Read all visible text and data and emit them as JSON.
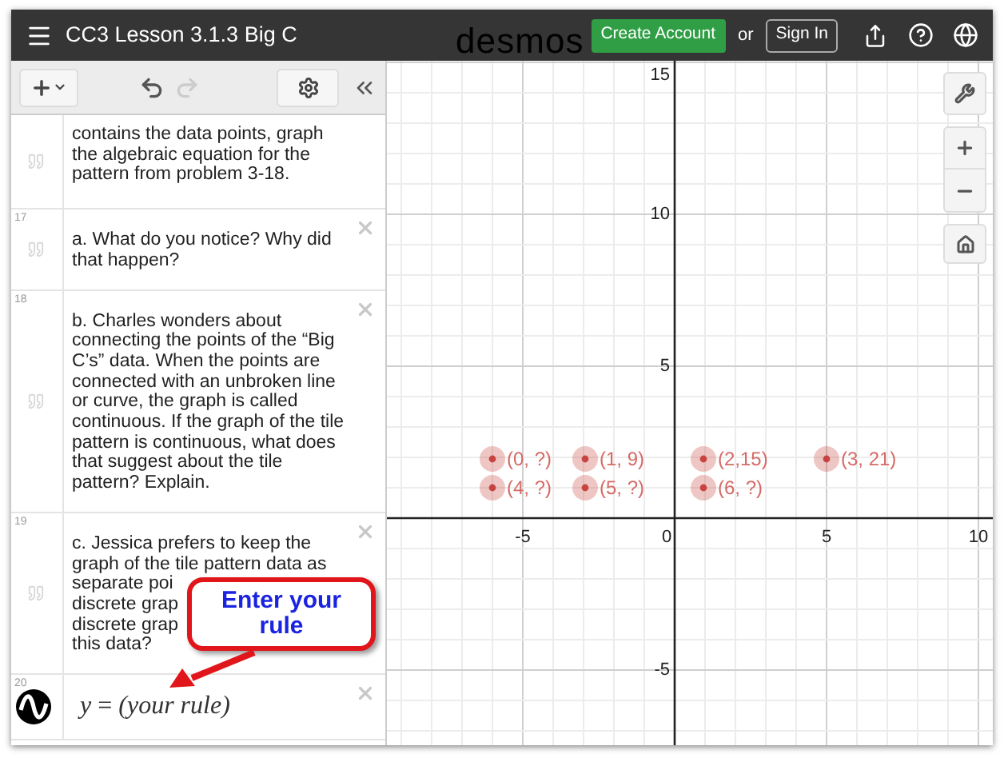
{
  "header": {
    "title": "CC3 Lesson 3.1.3 Big C",
    "brand": "desmos",
    "create_account": "Create Account",
    "or": "or",
    "sign_in": "Sign In"
  },
  "expressions": [
    {
      "kind": "note",
      "cut": true,
      "lines": [
        "contains the data points, graph",
        "the algebraic equation for the",
        "pattern from problem 3-18."
      ]
    },
    {
      "kind": "note",
      "cut": false,
      "number": "17",
      "lines": [
        "a. What do you notice? Why did",
        "that happen?"
      ]
    },
    {
      "kind": "note",
      "cut": false,
      "number": "18",
      "lines": [
        "b. Charles wonders about",
        "connecting the points of the “Big",
        "C’s” data.  When the points are",
        "connected with an unbroken line",
        "or curve, the graph is called",
        "continuous. If the graph of the tile",
        "pattern is continuous, what does",
        "that suggest about the tile",
        "pattern?  Explain."
      ]
    },
    {
      "kind": "note",
      "cut": false,
      "number": "19",
      "lines": [
        "c. Jessica prefers to keep the",
        "graph of the tile pattern data as",
        "separate poi",
        "discrete grap",
        "discrete grap",
        "this data?"
      ]
    },
    {
      "kind": "expression",
      "cut": false,
      "number": "20",
      "lhs": "y",
      "op": "=",
      "rhs": "(your rule)"
    }
  ],
  "graph": {
    "x_ticks": [
      "-5",
      "0",
      "5",
      "10"
    ],
    "y_ticks": [
      "15",
      "10",
      "5",
      "-5"
    ],
    "points": [
      {
        "label": "(0, ?)"
      },
      {
        "label": "(1, 9)"
      },
      {
        "label": "(2,15)"
      },
      {
        "label": "(3, 21)"
      },
      {
        "label": "(4, ?)"
      },
      {
        "label": "(5, ?)"
      },
      {
        "label": "(6, ?)"
      }
    ]
  },
  "callout": {
    "text": "Enter your rule"
  }
}
